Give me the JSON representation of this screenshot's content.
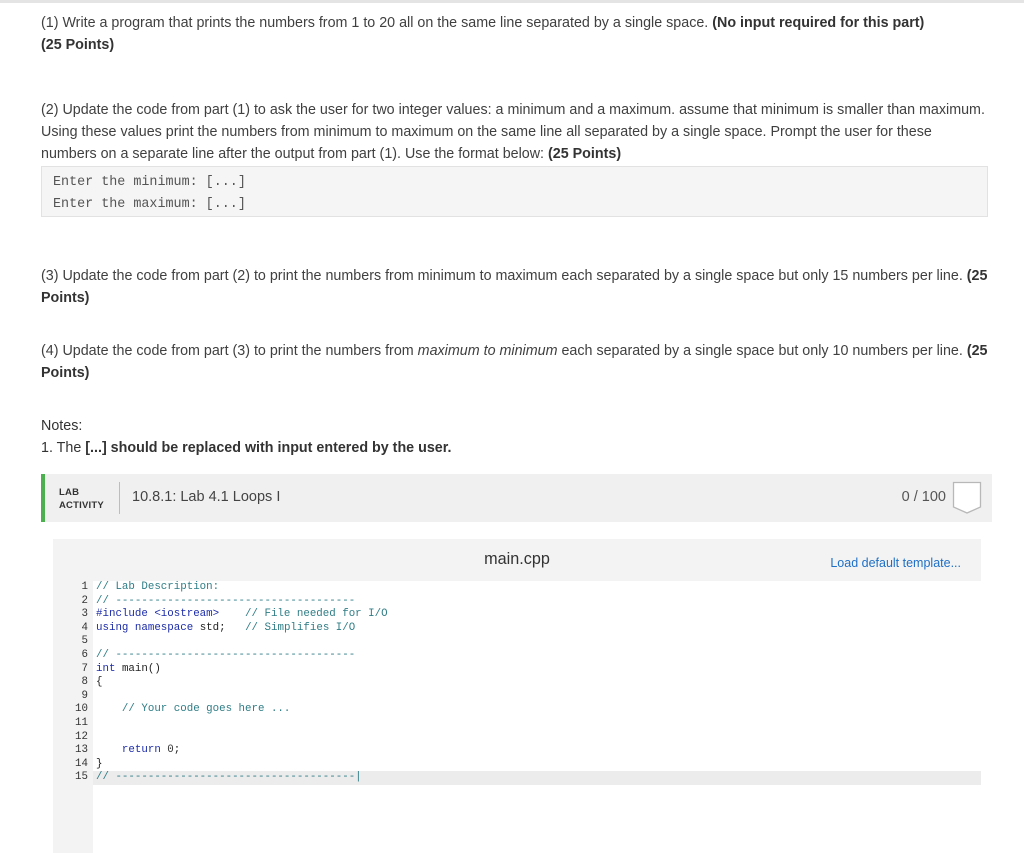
{
  "instructions": {
    "p1": {
      "text": "(1) Write a program that prints the numbers from 1 to 20 all on the same line separated by a single space.",
      "bold1": "(No input required for this part)",
      "bold2": "(25 Points)"
    },
    "p2": {
      "text": "(2) Update the code from part (1) to ask the user for two integer values: a minimum and a maximum. assume that minimum is smaller than maximum. Using these values print the numbers from minimum to maximum on the same line all separated by a single space. Prompt the user for these numbers on a separate line after the output from part (1). Use the format below:",
      "bold": "(25 Points)"
    },
    "format_lines": [
      "Enter the minimum: [...]",
      "Enter the maximum: [...]"
    ],
    "p3": {
      "text": "(3) Update the code from part (2) to print the numbers from minimum to maximum each separated by a single space but only 15 numbers per line.",
      "bold": "(25 Points)"
    },
    "p4": {
      "before": "(4) Update the code from part (3) to print the numbers from",
      "italic": "maximum to minimum",
      "after": "each separated by a single space but only 10 numbers per line.",
      "bold": "(25 Points)"
    },
    "notes_title": "Notes:",
    "note1_prefix": "1. The",
    "note1_bold": "[...] should be replaced with input entered by the user."
  },
  "lab": {
    "tag_line1": "LAB",
    "tag_line2": "ACTIVITY",
    "title": "10.8.1: Lab 4.1 Loops I",
    "score": "0 / 100"
  },
  "editor": {
    "filename": "main.cpp",
    "load_template": "Load default template...",
    "line_numbers": [
      "1",
      "2",
      "3",
      "4",
      "5",
      "6",
      "7",
      "8",
      "9",
      "10",
      "11",
      "12",
      "13",
      "14",
      "15"
    ],
    "code": {
      "l1": "// Lab Description:",
      "l2": "// -------------------------------------",
      "l3_pre": "#include <iostream>",
      "l3_cm": "// File needed for I/O",
      "l4_kw1": "using",
      "l4_kw2": "namespace",
      "l4_id": "std;",
      "l4_cm": "// Simplifies I/O",
      "l6": "// -------------------------------------",
      "l7_type": "int",
      "l7_rest": "main()",
      "l8": "{",
      "l10": "// Your code goes here ...",
      "l13_kw": "return",
      "l13_num": "0",
      "l13_end": ";",
      "l14": "}",
      "l15": "// -------------------------------------|"
    }
  }
}
